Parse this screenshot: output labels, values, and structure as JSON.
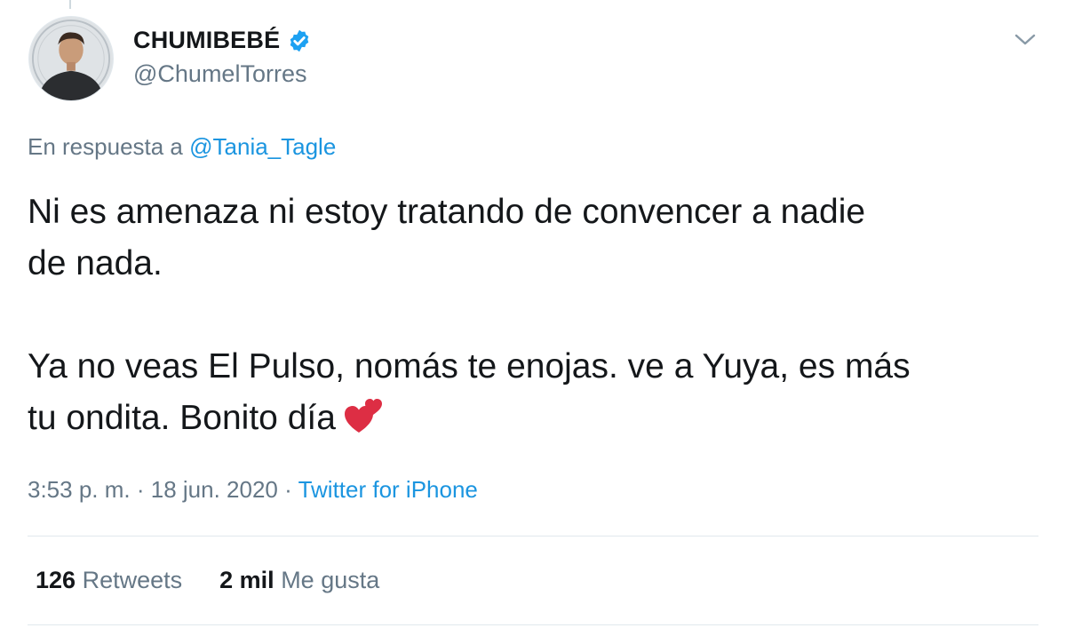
{
  "author": {
    "display_name": "CHUMIBEBÉ",
    "handle": "@ChumelTorres",
    "verified": true
  },
  "reply_to": {
    "prefix": "En respuesta a",
    "mention": "@Tania_Tagle"
  },
  "tweet": {
    "line1": "Ni es amenaza ni estoy tratando de convencer a nadie",
    "line2": "de nada.",
    "line3": "Ya no veas El Pulso, nomás te enojas. ve a Yuya, es más",
    "line4": "tu ondita. Bonito día"
  },
  "meta": {
    "time": "3:53 p. m.",
    "separator": "·",
    "date": "18 jun. 2020",
    "source": "Twitter for iPhone"
  },
  "stats": {
    "retweets_count": "126",
    "retweets_label": "Retweets",
    "likes_count": "2 mil",
    "likes_label": "Me gusta"
  },
  "colors": {
    "link": "#1b95e0",
    "secondary": "#657786",
    "verified": "#1da1f2",
    "heart": "#e0245e"
  },
  "icons": {
    "verified": "verified-badge-icon",
    "caret": "chevron-down-icon",
    "emoji": "two-hearts-icon"
  }
}
